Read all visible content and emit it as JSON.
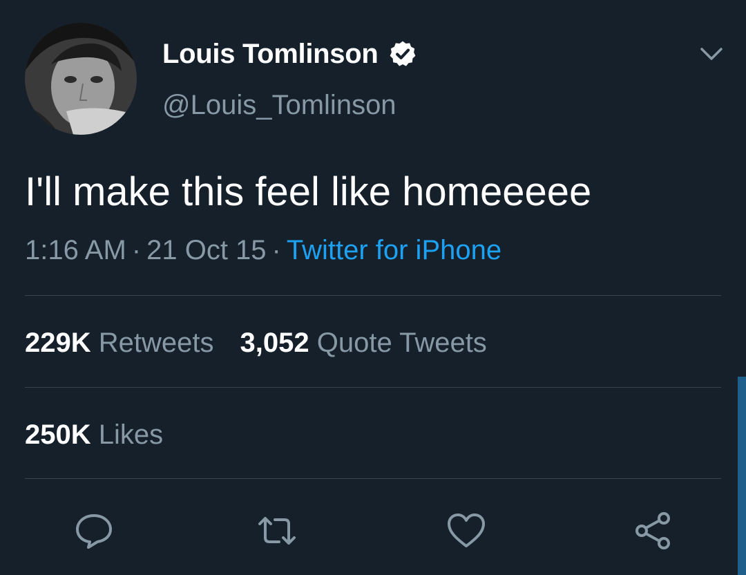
{
  "header": {
    "display_name": "Louis Tomlinson",
    "handle": "@Louis_Tomlinson",
    "verified_icon": "verified-badge-icon",
    "menu_icon": "chevron-down-icon"
  },
  "tweet": {
    "text": "I'll make this feel like homeeeee",
    "time": "1:16 AM",
    "date": "21 Oct 15",
    "separator": "·",
    "source": "Twitter for iPhone"
  },
  "stats": {
    "retweets_count": "229K",
    "retweets_label": "Retweets",
    "quote_count": "3,052",
    "quote_label": "Quote Tweets",
    "likes_count": "250K",
    "likes_label": "Likes"
  },
  "actions": [
    {
      "icon": "reply-icon"
    },
    {
      "icon": "retweet-icon"
    },
    {
      "icon": "like-icon"
    },
    {
      "icon": "share-icon"
    }
  ],
  "colors": {
    "background": "#16202b",
    "text_primary": "#ffffff",
    "text_secondary": "#8899a6",
    "link": "#1da1f2",
    "divider": "#38444d"
  }
}
